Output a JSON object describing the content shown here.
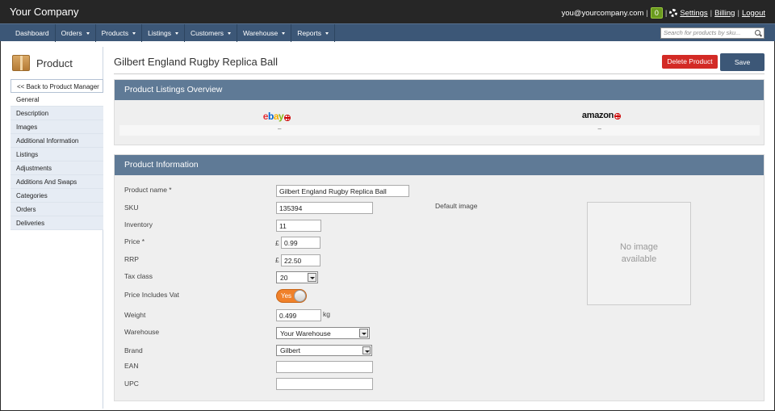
{
  "header": {
    "brand": "Your Company",
    "email": "you@yourcompany.com",
    "badge_count": "0",
    "settings": "Settings",
    "billing": "Billing",
    "logout": "Logout",
    "sep": "|"
  },
  "nav": {
    "items": [
      "Dashboard",
      "Orders",
      "Products",
      "Listings",
      "Customers",
      "Warehouse",
      "Reports"
    ],
    "search_placeholder": "Search for products by sku..."
  },
  "sidebar": {
    "title": "Product",
    "items": [
      "<< Back to Product Manager",
      "General",
      "Description",
      "Images",
      "Additional Information",
      "Listings",
      "Adjustments",
      "Additions And Swaps",
      "Categories",
      "Orders",
      "Deliveries"
    ]
  },
  "page": {
    "title": "Gilbert England Rugby Replica Ball",
    "delete_label": "Delete Product",
    "save_label": "Save"
  },
  "listings_panel": {
    "title": "Product Listings Overview",
    "channels": [
      {
        "name": "ebay",
        "value": "–"
      },
      {
        "name": "amazon",
        "value": "–"
      }
    ]
  },
  "info_panel": {
    "title": "Product Information",
    "fields": {
      "name_label": "Product name *",
      "name_value": "Gilbert England Rugby Replica Ball",
      "sku_label": "SKU",
      "sku_value": "135394",
      "inventory_label": "Inventory",
      "inventory_value": "11",
      "price_label": "Price *",
      "price_value": "0.99",
      "rrp_label": "RRP",
      "rrp_value": "22.50",
      "currency": "£",
      "tax_label": "Tax class",
      "tax_value": "20",
      "vat_label": "Price Includes Vat",
      "vat_value": "Yes",
      "weight_label": "Weight",
      "weight_value": "0.499",
      "weight_unit": "kg",
      "warehouse_label": "Warehouse",
      "warehouse_value": "Your Warehouse",
      "brand_label": "Brand",
      "brand_value": "Gilbert",
      "ean_label": "EAN",
      "ean_value": "",
      "upc_label": "UPC",
      "upc_value": "",
      "default_image_label": "Default image",
      "no_image_text": "No image available"
    }
  },
  "colors": {
    "topbar": "#262626",
    "nav": "#3c5777",
    "panel_header": "#5f7a96",
    "delete": "#d32a25",
    "toggle_on": "#f0812a"
  }
}
